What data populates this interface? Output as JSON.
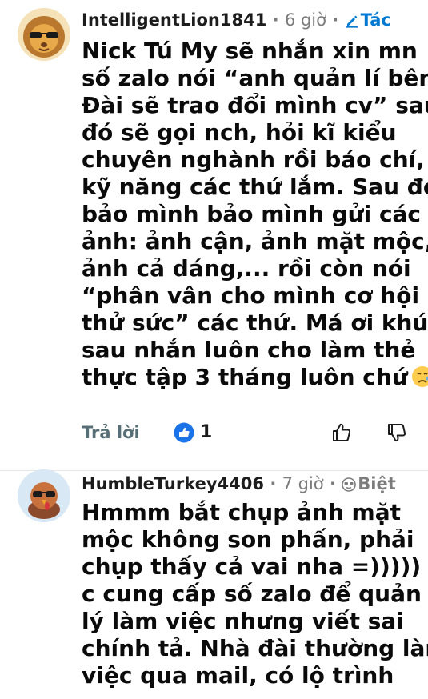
{
  "comments": [
    {
      "username": "IntelligentLion1841",
      "separator": "·",
      "time": "6 giờ",
      "separator2": "·",
      "flair": "Tác",
      "lines": [
        "Nick Tú My sẽ nhắn xin mn",
        "số zalo nói “anh quản lí bên",
        "Đài sẽ trao đổi mình cv” sau",
        "đó sẽ gọi nch, hỏi kĩ kiểu",
        "chuyên nghành rồi báo chí,",
        "kỹ năng các thứ lắm. Sau đó",
        "bảo mình bảo mình gửi các",
        "ảnh: ảnh cận, ảnh mặt mộc,",
        "ảnh cả dáng,... rồi còn nói",
        "“phân vân cho mình cơ hội",
        "thử sức” các thứ. Má ơi khúc",
        "sau nhắn luôn cho làm thẻ",
        "thực tập 3 tháng luôn chứ"
      ],
      "emoji": "crying-face-emoji",
      "reply_label": "Trả lời",
      "award_count": "1",
      "avatar_icon": "lion-sunglasses-avatar",
      "award_color": "#1a73e8"
    },
    {
      "username": "HumbleTurkey4406",
      "separator": "·",
      "time": "7 giờ",
      "separator2": "·",
      "flair": "Biệt",
      "lines": [
        "Hmmm bắt chụp ảnh mặt",
        "mộc không son phấn, phải",
        "chụp thấy cả vai nha =))))) y/",
        "c cung cấp số zalo để quản",
        "lý làm việc nhưng viết sai",
        "chính tả. Nhà đài thường làm",
        "việc qua mail, có lộ trình"
      ],
      "avatar_icon": "turkey-sunglasses-avatar"
    }
  ]
}
